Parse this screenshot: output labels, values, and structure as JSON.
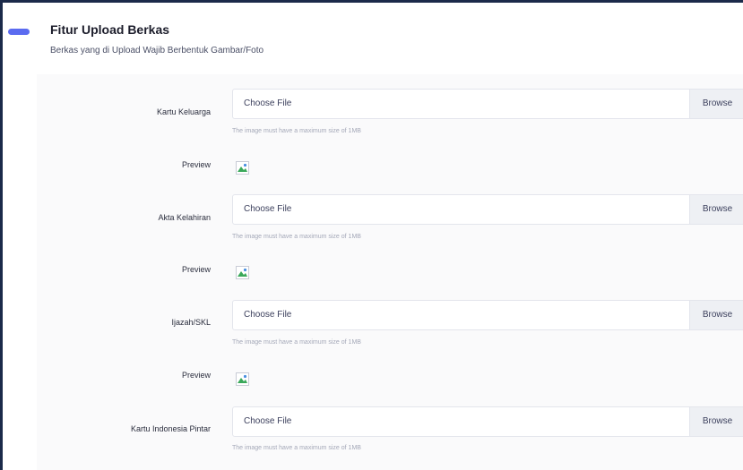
{
  "section": {
    "title": "Fitur Upload Berkas",
    "subtitle": "Berkas yang di Upload Wajib Berbentuk Gambar/Foto"
  },
  "fields": [
    {
      "label": "Kartu Keluarga",
      "file_text": "Choose File",
      "browse_label": "Browse",
      "hint": "The image must have a maximum size of 1MB",
      "preview_label": "Preview",
      "preview_icon": "broken-image-icon"
    },
    {
      "label": "Akta Kelahiran",
      "file_text": "Choose File",
      "browse_label": "Browse",
      "hint": "The image must have a maximum size of 1MB",
      "preview_label": "Preview",
      "preview_icon": "broken-image-icon"
    },
    {
      "label": "Ijazah/SKL",
      "file_text": "Choose File",
      "browse_label": "Browse",
      "hint": "The image must have a maximum size of 1MB",
      "preview_label": "Preview",
      "preview_icon": "broken-image-icon"
    },
    {
      "label": "Kartu Indonesia Pintar",
      "file_text": "Choose File",
      "browse_label": "Browse",
      "hint": "The image must have a maximum size of 1MB"
    }
  ],
  "colors": {
    "accent": "#5b6bf0",
    "frame": "#1b2a4a",
    "panel": "#fafafb",
    "browse_bg": "#eef0f4"
  }
}
